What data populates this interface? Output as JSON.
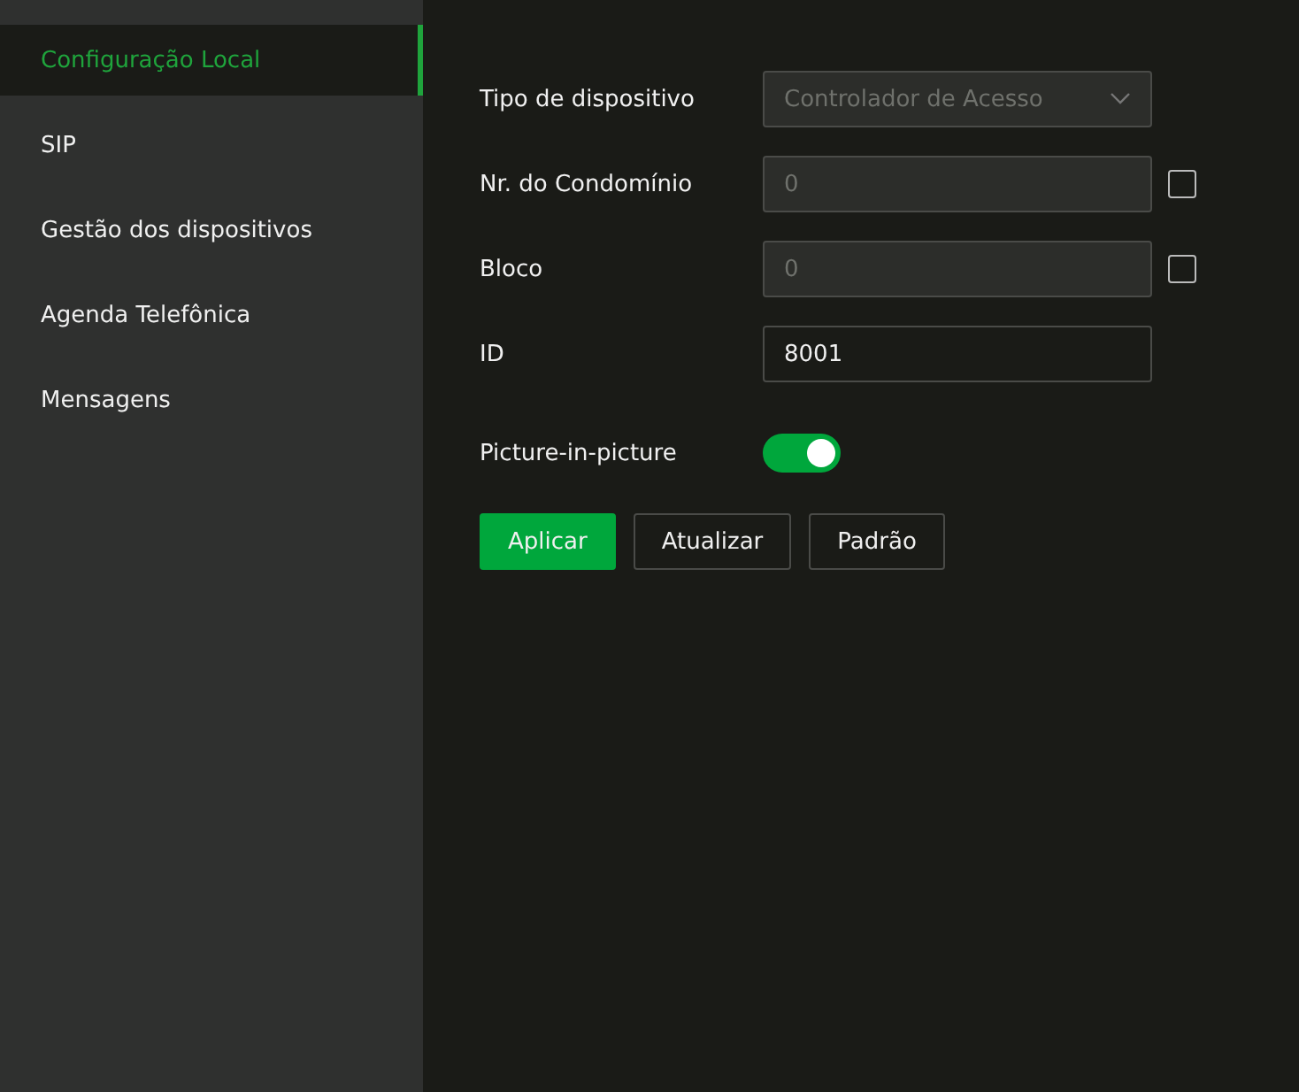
{
  "sidebar": {
    "items": [
      {
        "label": "Configuração Local",
        "selected": true
      },
      {
        "label": "SIP",
        "selected": false
      },
      {
        "label": "Gestão dos dispositivos",
        "selected": false
      },
      {
        "label": "Agenda Telefônica",
        "selected": false
      },
      {
        "label": "Mensagens",
        "selected": false
      }
    ]
  },
  "form": {
    "fields": [
      {
        "kind": "select",
        "label": "Tipo de dispositivo",
        "value": "Controlador de Acesso",
        "disabled": true
      },
      {
        "kind": "text",
        "label": "Nr. do Condomínio",
        "value": "0",
        "disabled": true,
        "checked": false
      },
      {
        "kind": "text",
        "label": "Bloco",
        "value": "0",
        "disabled": true,
        "checked": false
      },
      {
        "kind": "text",
        "label": "ID",
        "value": "8001",
        "disabled": false
      }
    ],
    "toggle": {
      "label": "Picture-in-picture",
      "on": true
    },
    "buttons": [
      {
        "label": "Aplicar",
        "kind": "primary"
      },
      {
        "label": "Atualizar",
        "kind": "secondary"
      },
      {
        "label": "Padrão",
        "kind": "secondary"
      }
    ]
  }
}
